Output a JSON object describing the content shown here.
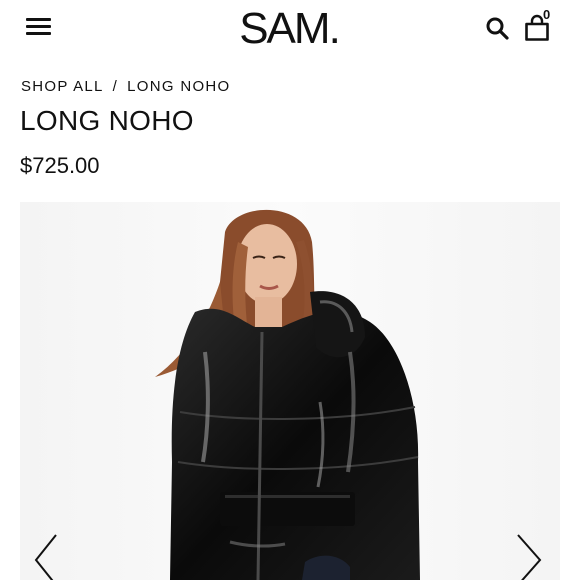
{
  "header": {
    "logo": "SAM",
    "logo_dot": ".",
    "cart_count": "0"
  },
  "breadcrumb": {
    "items": [
      "SHOP ALL",
      "LONG NOHO"
    ],
    "separator": "/"
  },
  "product": {
    "title": "LONG NOHO",
    "price": "$725.00"
  },
  "icons": {
    "menu": "hamburger-icon",
    "search": "search-icon",
    "cart": "shopping-bag-icon",
    "prev": "chevron-left-icon",
    "next": "chevron-right-icon"
  },
  "colors": {
    "text": "#111111",
    "background": "#ffffff",
    "photo_background": "#f6f6f6"
  }
}
